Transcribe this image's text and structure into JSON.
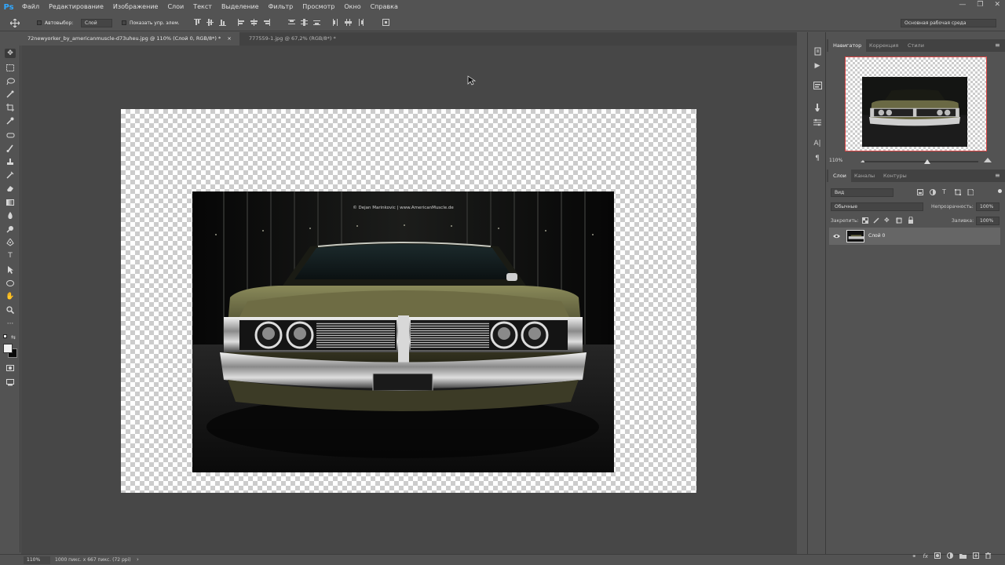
{
  "app": {
    "logo": "Ps"
  },
  "menu": [
    "Файл",
    "Редактирование",
    "Изображение",
    "Слои",
    "Текст",
    "Выделение",
    "Фильтр",
    "Просмотр",
    "Окно",
    "Справка"
  ],
  "window_controls": [
    "—",
    "❐",
    "✕"
  ],
  "options": {
    "autoselect_label": "Автовыбор:",
    "autoselect_value": "Слой",
    "show_transform_label": "Показать упр. элем.",
    "workspace": "Основная рабочая среда"
  },
  "tabs": [
    {
      "label": "72newyorker_by_americanmuscle-d73uheu.jpg @ 110% (Слой 0, RGB/8*) *",
      "close": "×"
    },
    {
      "label": "777559-1.jpg @ 67,2% (RGB/8*) *",
      "close": "×"
    }
  ],
  "photo": {
    "credit": "© Dejan Marinkovic  |  www.AmericanMuscle.de"
  },
  "status": {
    "zoom": "110%",
    "doc_info": "1000 пикс. x 667 пикс. (72 ppi)",
    "arrow": "›"
  },
  "navigator": {
    "tabs": [
      "Навигатор",
      "Коррекция",
      "Стили"
    ],
    "zoom": "110%"
  },
  "layers": {
    "tabs": [
      "Слои",
      "Каналы",
      "Контуры"
    ],
    "filter_kind": "Вид",
    "blend_mode": "Обычные",
    "opacity_label": "Непрозрачность:",
    "opacity_value": "100%",
    "lock_label": "Закрепить:",
    "fill_label": "Заливка:",
    "fill_value": "100%",
    "items": [
      {
        "name": "Слой 0",
        "visible": true
      }
    ]
  },
  "colors": {
    "accent": "#31a8ff",
    "nav_frame": "#dd4444"
  }
}
